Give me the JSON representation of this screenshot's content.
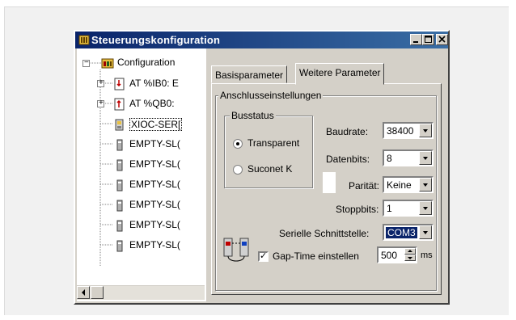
{
  "window": {
    "title": "Steuerungskonfiguration",
    "minimize": "minimize-button",
    "maximize": "maximize-button",
    "close": "close-button"
  },
  "tree": {
    "root": "Configuration",
    "items": [
      {
        "label": "AT %IB0: E",
        "icon": "input-module-icon"
      },
      {
        "label": "AT %QB0:",
        "icon": "output-module-icon"
      },
      {
        "label": "XIOC-SER[",
        "icon": "serial-module-icon"
      },
      {
        "label": "EMPTY-SL(",
        "icon": "empty-slot-icon"
      },
      {
        "label": "EMPTY-SL(",
        "icon": "empty-slot-icon"
      },
      {
        "label": "EMPTY-SL(",
        "icon": "empty-slot-icon"
      },
      {
        "label": "EMPTY-SL(",
        "icon": "empty-slot-icon"
      },
      {
        "label": "EMPTY-SL(",
        "icon": "empty-slot-icon"
      },
      {
        "label": "EMPTY-SL(",
        "icon": "empty-slot-icon"
      }
    ]
  },
  "tabs": {
    "basis": "Basisparameter",
    "weitere": "Weitere Parameter"
  },
  "anschluss": {
    "group_label": "Anschlusseinstellungen",
    "busstatus_label": "Busstatus",
    "radio_transparent": "Transparent",
    "radio_suconet": "Suconet K",
    "baudrate_label": "Baudrate:",
    "baudrate_value": "38400",
    "datenbits_label": "Datenbits:",
    "datenbits_value": "8",
    "paritaet_label": "Parität:",
    "paritaet_value": "Keine",
    "stoppbits_label": "Stoppbits:",
    "stoppbits_value": "1",
    "schnittstelle_label": "Serielle Schnittstelle:",
    "schnittstelle_value": "COM3",
    "gap_label": "Gap-Time einstellen",
    "gap_value": "500",
    "gap_unit": "ms",
    "gap_checked": true
  },
  "colors": {
    "titlebar_start": "#0a246a",
    "titlebar_end": "#3a6ea5",
    "face": "#d4d0c8",
    "selection": "#0a246a"
  }
}
